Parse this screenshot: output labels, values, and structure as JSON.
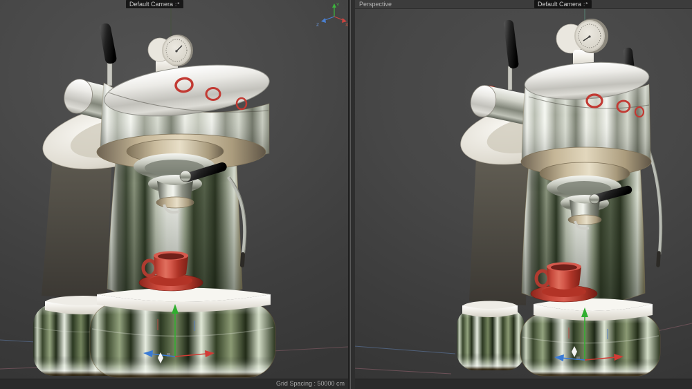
{
  "viewports": {
    "left": {
      "camera_label": "Default Camera",
      "camera_icon": ":*",
      "axis": {
        "x": "X",
        "y": "Y",
        "z": "Z"
      }
    },
    "right": {
      "title": "Perspective",
      "camera_label": "Default Camera",
      "camera_icon": ":*"
    }
  },
  "status_bar": {
    "grid_spacing": "Grid Spacing : 50000 cm"
  },
  "colors": {
    "axis_green": "#2fae2f",
    "axis_red": "#d23b35",
    "axis_blue": "#3a7bd5",
    "cup_red": "#c0392b",
    "viewport_bg": "#474747",
    "panel_bg": "#2b2b2b"
  }
}
